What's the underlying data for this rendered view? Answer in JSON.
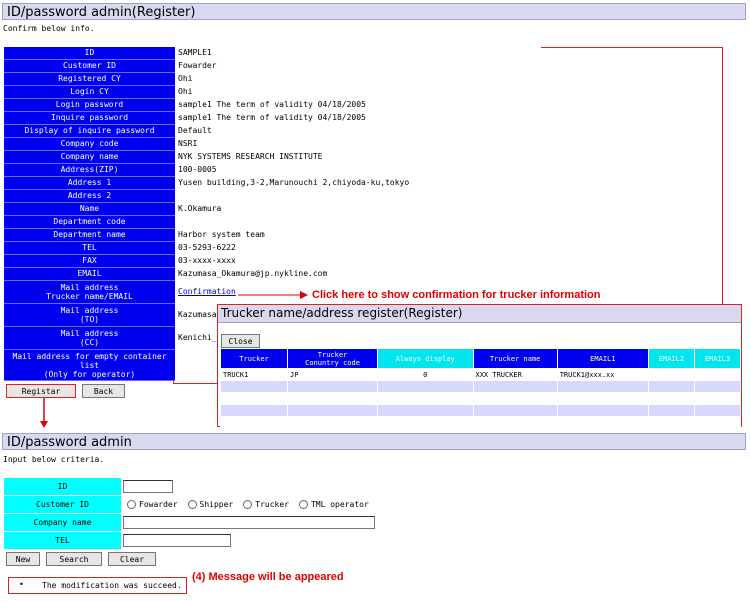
{
  "register": {
    "title": "ID/password admin(Register)",
    "subtitle": "Confirm below info.",
    "rows": [
      {
        "label": "ID",
        "value": "SAMPLE1"
      },
      {
        "label": "Customer ID",
        "value": "Fowarder"
      },
      {
        "label": "Registered CY",
        "value": "Ohi"
      },
      {
        "label": "Login CY",
        "value": "Ohi"
      },
      {
        "label": "Login password",
        "value": "sample1 The term of validity 04/18/2005"
      },
      {
        "label": "Inquire password",
        "value": "sample1 The term of validity 04/18/2005"
      },
      {
        "label": "Display of inquire password",
        "value": "Default"
      },
      {
        "label": "Company code",
        "value": "NSRI"
      },
      {
        "label": "Company name",
        "value": "NYK SYSTEMS RESEARCH INSTITUTE"
      },
      {
        "label": "Address(ZIP)",
        "value": "100-0005"
      },
      {
        "label": "Address 1",
        "value": "Yusen building,3-2,Marunouchi 2,chiyoda-ku,tokyo"
      },
      {
        "label": "Address 2",
        "value": ""
      },
      {
        "label": "Name",
        "value": "K.Okamura"
      },
      {
        "label": "Department code",
        "value": ""
      },
      {
        "label": "Department name",
        "value": "Harbor system team"
      },
      {
        "label": "TEL",
        "value": "03-5293-6222"
      },
      {
        "label": "FAX",
        "value": "03-xxxx-xxxx"
      },
      {
        "label": "EMAIL",
        "value": "Kazumasa_Okamura@jp.nykline.com"
      }
    ],
    "trucker_row": {
      "label1": "Mail address",
      "label2": "Trucker name/EMAIL",
      "link": "Confirmation"
    },
    "to_row": {
      "label1": "Mail address",
      "label2": "(TO)",
      "value": "Kazumasa"
    },
    "cc_row": {
      "label1": "Mail address",
      "label2": "(CC)",
      "value": "Kenichi_"
    },
    "empty_row": {
      "label1": "Mail address for empty container",
      "label2": "list",
      "label3": "(Only for operator)"
    },
    "buttons": {
      "register": "Registar",
      "back": "Back"
    }
  },
  "annotations": {
    "click_here": "Click here to show confirmation for trucker information",
    "message": "(4) Message will be appeared"
  },
  "popup": {
    "title": "Trucker name/address register(Register)",
    "close": "Close",
    "headers": [
      "Trucker",
      "Trucker\nConuntry code",
      "Always display",
      "Trucker name",
      "EMAIL1",
      "EMAIL2",
      "EMAIL3"
    ],
    "rows": [
      [
        "TRUCK1",
        "JP",
        "0",
        "XXX TRUCKER",
        "TRUCK1@xxx.xx",
        "",
        ""
      ],
      [
        "",
        "",
        "",
        "",
        "",
        "",
        ""
      ],
      [
        "",
        "",
        "",
        "",
        "",
        "",
        ""
      ],
      [
        "",
        "",
        "",
        "",
        "",
        "",
        ""
      ],
      [
        "",
        "",
        "",
        "",
        "",
        "",
        ""
      ]
    ]
  },
  "search": {
    "title": "ID/password admin",
    "subtitle": "Input below criteria.",
    "labels": {
      "id": "ID",
      "customer": "Customer ID",
      "company": "Company name",
      "tel": "TEL"
    },
    "radios": [
      "Fowarder",
      "Shipper",
      "Trucker",
      "TML operator"
    ],
    "buttons": {
      "new": "New",
      "search": "Search",
      "clear": "Clear"
    },
    "message": "The modification was succeed."
  },
  "colors": {
    "label_bg": "#0000ee",
    "cyan": "#00ffff",
    "red": "#e00000"
  }
}
